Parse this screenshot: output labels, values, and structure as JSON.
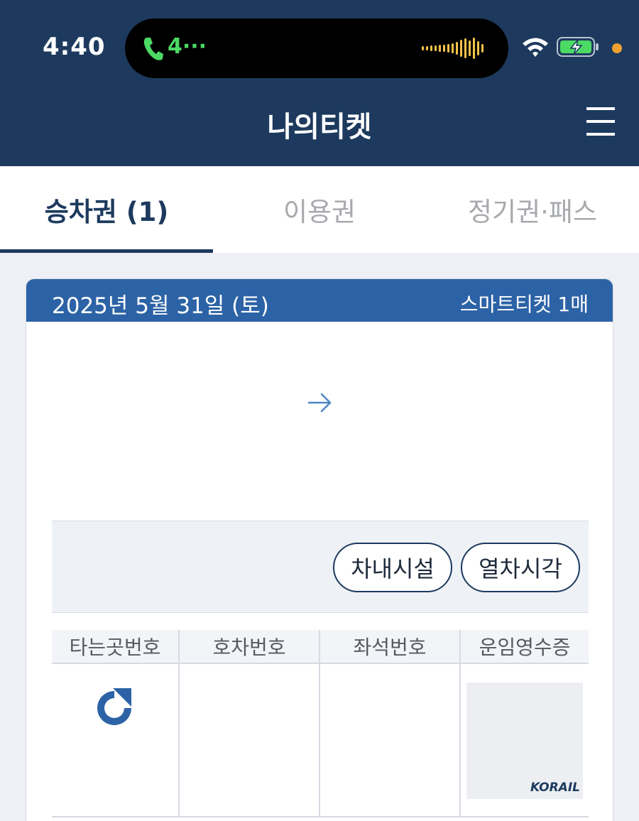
{
  "status_bar": {
    "time": "4:40",
    "call_indicator": "4···",
    "icons": [
      "phone-icon",
      "audio-wave-icon",
      "wifi-icon",
      "battery-charging-icon",
      "privacy-dot"
    ]
  },
  "header": {
    "title": "나의티켓",
    "menu_icon": "hamburger-menu-icon"
  },
  "tabs": [
    {
      "label": "승차권 (1)",
      "active": true
    },
    {
      "label": "이용권",
      "active": false
    },
    {
      "label": "정기권·패스",
      "active": false
    }
  ],
  "ticket": {
    "date": "2025년 5월 31일 (토)",
    "ticket_type": "스마트티켓 1매",
    "route_icon": "arrow-right-icon",
    "buttons": {
      "facilities": "차내시설",
      "timetable": "열차시각"
    },
    "columns": [
      "타는곳번호",
      "호차번호",
      "좌석번호",
      "운임영수증"
    ],
    "refresh_icon": "refresh-icon",
    "receipt_logo": "KORAIL"
  },
  "colors": {
    "header_bg": "#1d3a5e",
    "card_header_bg": "#2c63a6",
    "accent": "#2c63a6",
    "page_bg": "#eef0f5"
  }
}
